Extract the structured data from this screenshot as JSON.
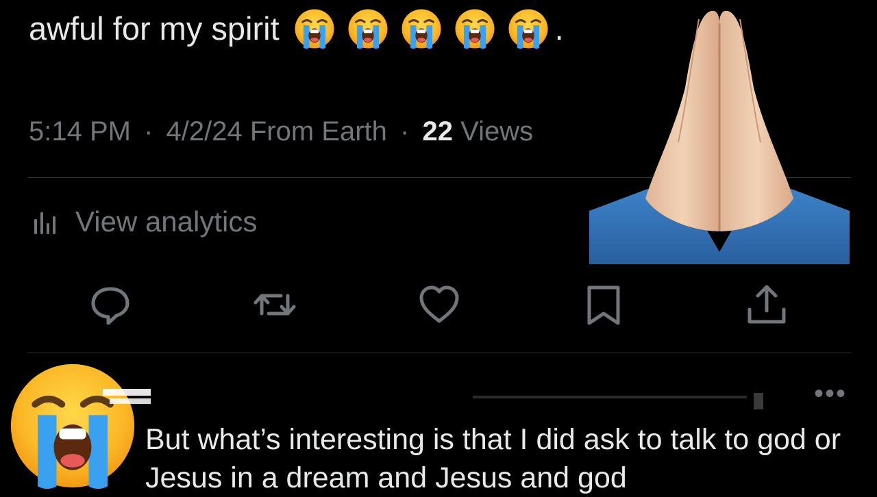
{
  "tweet": {
    "text": "awful for my spirit",
    "emoji_icons": [
      "loudly-crying-face-icon",
      "loudly-crying-face-icon",
      "loudly-crying-face-icon",
      "loudly-crying-face-icon",
      "loudly-crying-face-icon"
    ],
    "end": ".",
    "time": "5:14 PM",
    "separator": "·",
    "date_source": "4/2/24 From Earth",
    "views_count": "22",
    "views_label": "Views"
  },
  "analytics": {
    "label": "View analytics",
    "icon": "analytics-bars-icon"
  },
  "actions": [
    {
      "name": "reply",
      "icon": "reply-bubble-icon"
    },
    {
      "name": "retweet",
      "icon": "retweet-icon"
    },
    {
      "name": "like",
      "icon": "heart-icon"
    },
    {
      "name": "bookmark",
      "icon": "bookmark-icon"
    },
    {
      "name": "share",
      "icon": "share-upload-icon"
    }
  ],
  "overlays": {
    "top_right": "folded-hands-emoji",
    "bottom_left": "loudly-crying-face-emoji"
  },
  "reply": {
    "more_glyph": "•••",
    "text": "But what’s interesting is that I did ask to talk to god or Jesus in a dream and Jesus and god"
  },
  "colors": {
    "background": "#000000",
    "primary_text": "#e7e9ea",
    "secondary_text": "#71767b",
    "divider": "#2f3336"
  }
}
